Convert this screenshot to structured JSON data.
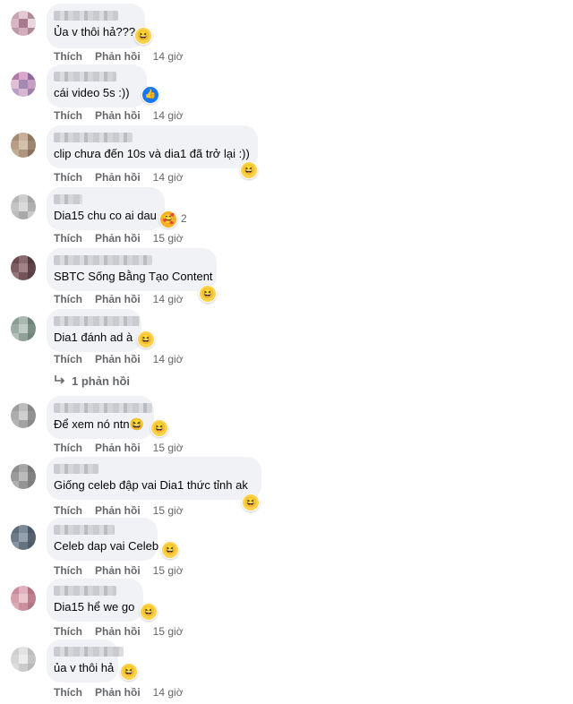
{
  "actions": {
    "like": "Thích",
    "reply": "Phản hồi"
  },
  "comments": [
    {
      "text": "Ủa v thôi hả???",
      "time": "14 giờ",
      "reaction": "haha-icon",
      "reaction_glyph": "😆"
    },
    {
      "text": "cái video 5s :))",
      "time": "14 giờ",
      "reaction": "like-icon",
      "reaction_glyph": "👍"
    },
    {
      "text": "clip chưa đến 10s và dia1 đã trở lại :))",
      "time": "14 giờ",
      "reaction": "haha-icon",
      "reaction_glyph": "😆"
    },
    {
      "text": "Dia15 chu co ai dau",
      "time": "15 giờ",
      "reaction": "care-icon",
      "reaction_glyph": "🥰",
      "reaction_count": "2"
    },
    {
      "text": "SBTC Sống Bằng Tạo Content",
      "time": "14 giờ",
      "reaction": "haha-icon",
      "reaction_glyph": "😆"
    },
    {
      "text": "Dia1 đánh ad à",
      "time": "14 giờ",
      "reaction": "haha-icon",
      "reaction_glyph": "😆",
      "replies": "1 phản hồi"
    },
    {
      "text": "Để xem nó ntn😆",
      "time": "15 giờ",
      "reaction": "haha-icon",
      "reaction_glyph": "😆"
    },
    {
      "text": "Giống celeb đập vai Dia1 thức tỉnh ak",
      "time": "15 giờ",
      "reaction": "haha-icon",
      "reaction_glyph": "😆"
    },
    {
      "text": "Celeb dap vai Celeb",
      "time": "15 giờ",
      "reaction": "haha-icon",
      "reaction_glyph": "😆"
    },
    {
      "text": "Dia15 hể we go",
      "time": "15 giờ",
      "reaction": "haha-icon",
      "reaction_glyph": "😆"
    },
    {
      "text": "ủa v thôi hả",
      "time": "14 giờ",
      "reaction": "haha-icon",
      "reaction_glyph": "😆"
    }
  ]
}
